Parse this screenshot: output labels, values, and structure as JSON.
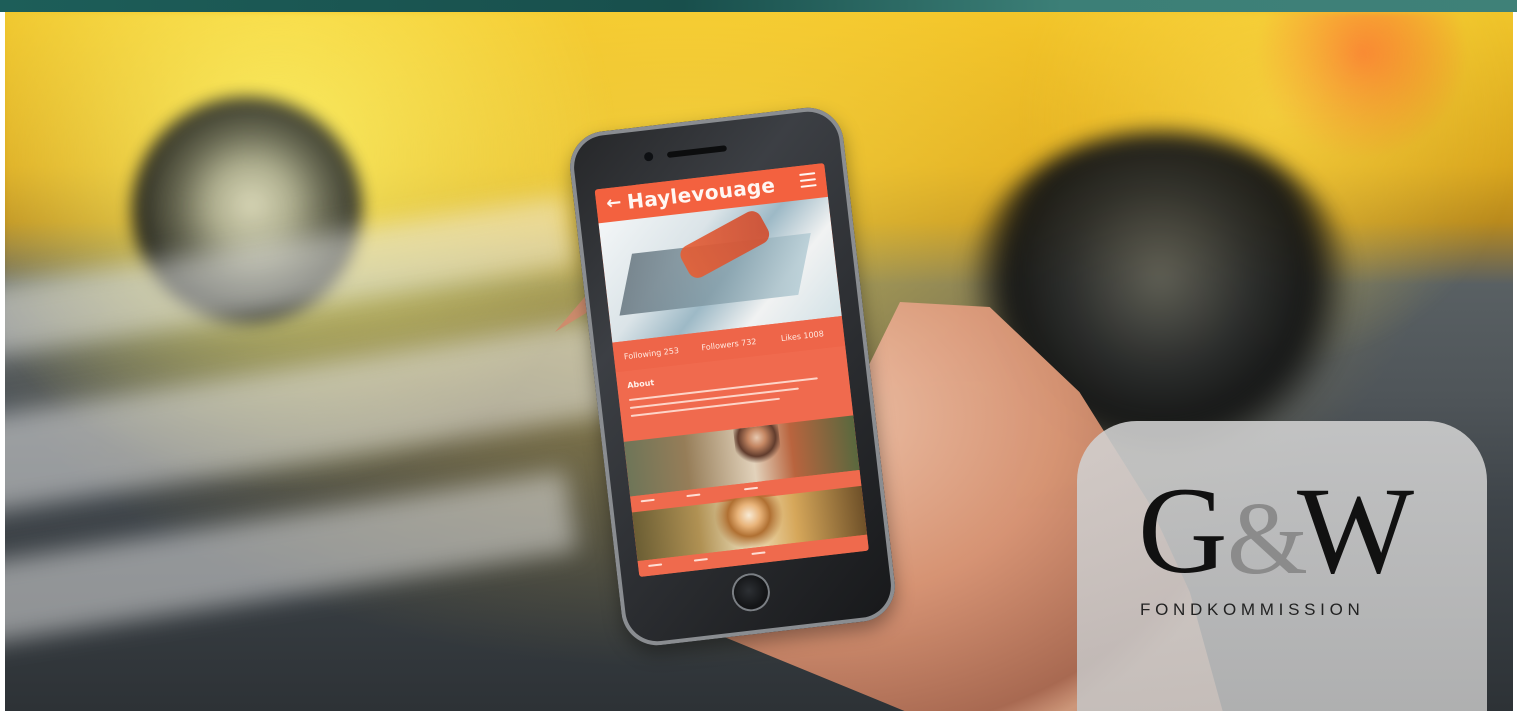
{
  "phone_app": {
    "back_icon": "←",
    "title": "Haylevouage",
    "stats": {
      "following_label": "Following",
      "following_value": "253",
      "followers_label": "Followers",
      "followers_value": "732",
      "likes_label": "Likes",
      "likes_value": "1008"
    },
    "about_title": "About"
  },
  "logo": {
    "left": "G",
    "ampersand": "&",
    "right": "W",
    "subtitle": "FONDKOMMISSION"
  },
  "colors": {
    "accent": "#f3613f",
    "logo_gray": "#8b8b8b",
    "band": "#1d5e59"
  }
}
